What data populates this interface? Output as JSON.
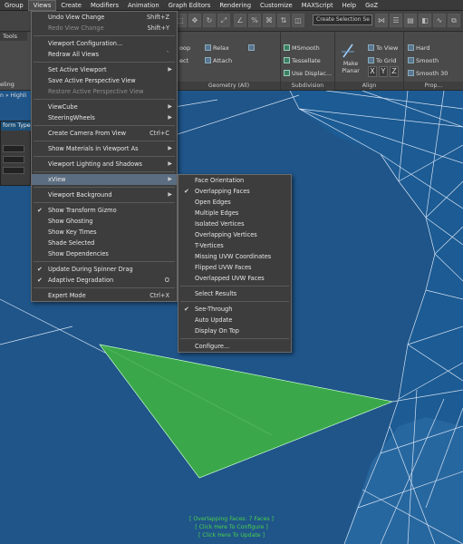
{
  "menubar": [
    "Group",
    "Views",
    "Create",
    "Modifiers",
    "Animation",
    "Graph Editors",
    "Rendering",
    "Customize",
    "MAXScript",
    "Help",
    "GoZ"
  ],
  "toolbar": {
    "selection_set": "Create Selection Se"
  },
  "ribbon": {
    "tools_label": "Tools",
    "groups": {
      "geometry": "Geometry (All)",
      "subdivision": "Subdivision",
      "align": "Align",
      "props": "Prop..."
    },
    "items": {
      "relax": "Relax",
      "attach": "Attach",
      "msmooth": "MSmooth",
      "tessellate": "Tessellate",
      "use_displace": "Use Displac...",
      "make_planar": "Make Planar",
      "to_view": "To View",
      "to_grid": "To Grid",
      "x": "X",
      "y": "Y",
      "z": "Z",
      "hard": "Hard",
      "smooth": "Smooth",
      "smooth30": "Smooth 30",
      "oop": "oop",
      "ect": "ect",
      "eling": "eling"
    }
  },
  "left": {
    "breadcrumb": "n » Highli",
    "transform_title": "form Type-I"
  },
  "views_menu": [
    {
      "label": "Undo View Change",
      "shortcut": "Shift+Z"
    },
    {
      "label": "Redo View Change",
      "shortcut": "Shift+Y",
      "disabled": true
    },
    {
      "sep": true
    },
    {
      "label": "Viewport Configuration..."
    },
    {
      "label": "Redraw All Views",
      "shortcut": "`"
    },
    {
      "sep": true
    },
    {
      "label": "Set Active Viewport",
      "submenu": true
    },
    {
      "label": "Save Active Perspective View"
    },
    {
      "label": "Restore Active Perspective View",
      "disabled": true
    },
    {
      "sep": true
    },
    {
      "label": "ViewCube",
      "submenu": true
    },
    {
      "label": "SteeringWheels",
      "submenu": true
    },
    {
      "sep": true
    },
    {
      "label": "Create Camera From View",
      "shortcut": "Ctrl+C"
    },
    {
      "sep": true
    },
    {
      "label": "Show Materials in Viewport As",
      "submenu": true
    },
    {
      "sep": true
    },
    {
      "label": "Viewport Lighting and Shadows",
      "submenu": true
    },
    {
      "sep": true
    },
    {
      "label": "xView",
      "submenu": true,
      "highlight": true
    },
    {
      "sep": true
    },
    {
      "label": "Viewport Background",
      "submenu": true
    },
    {
      "sep": true
    },
    {
      "label": "Show Transform Gizmo",
      "checked": true
    },
    {
      "label": "Show Ghosting"
    },
    {
      "label": "Show Key Times"
    },
    {
      "label": "Shade Selected"
    },
    {
      "label": "Show Dependencies"
    },
    {
      "sep": true
    },
    {
      "label": "Update During Spinner Drag",
      "checked": true
    },
    {
      "label": "Adaptive Degradation",
      "shortcut": "O",
      "checked": true
    },
    {
      "sep": true
    },
    {
      "label": "Expert Mode",
      "shortcut": "Ctrl+X"
    }
  ],
  "xview_menu": [
    {
      "label": "Face Orientation"
    },
    {
      "label": "Overlapping Faces",
      "checked": true
    },
    {
      "label": "Open Edges"
    },
    {
      "label": "Multiple Edges"
    },
    {
      "label": "Isolated Vertices"
    },
    {
      "label": "Overlapping Vertices"
    },
    {
      "label": "T-Vertices"
    },
    {
      "label": "Missing UVW Coordinates"
    },
    {
      "label": "Flipped UVW Faces"
    },
    {
      "label": "Overlapped UVW Faces"
    },
    {
      "sep": true
    },
    {
      "label": "Select Results"
    },
    {
      "sep": true
    },
    {
      "label": "See-Through",
      "checked": true
    },
    {
      "label": "Auto Update"
    },
    {
      "label": "Display On Top"
    },
    {
      "sep": true
    },
    {
      "label": "Configure..."
    }
  ],
  "status": {
    "line1": "[ Overlapping Faces: 7 Faces ]",
    "line2": "[ Click Here To Configure ]",
    "line3": "[ Click Here To Update ]"
  },
  "colors": {
    "viewport_bg": "#1f5589",
    "mesh_fill": "#1c5d95",
    "highlight_face": "#3aa84a",
    "status_text": "#4cd04c"
  }
}
